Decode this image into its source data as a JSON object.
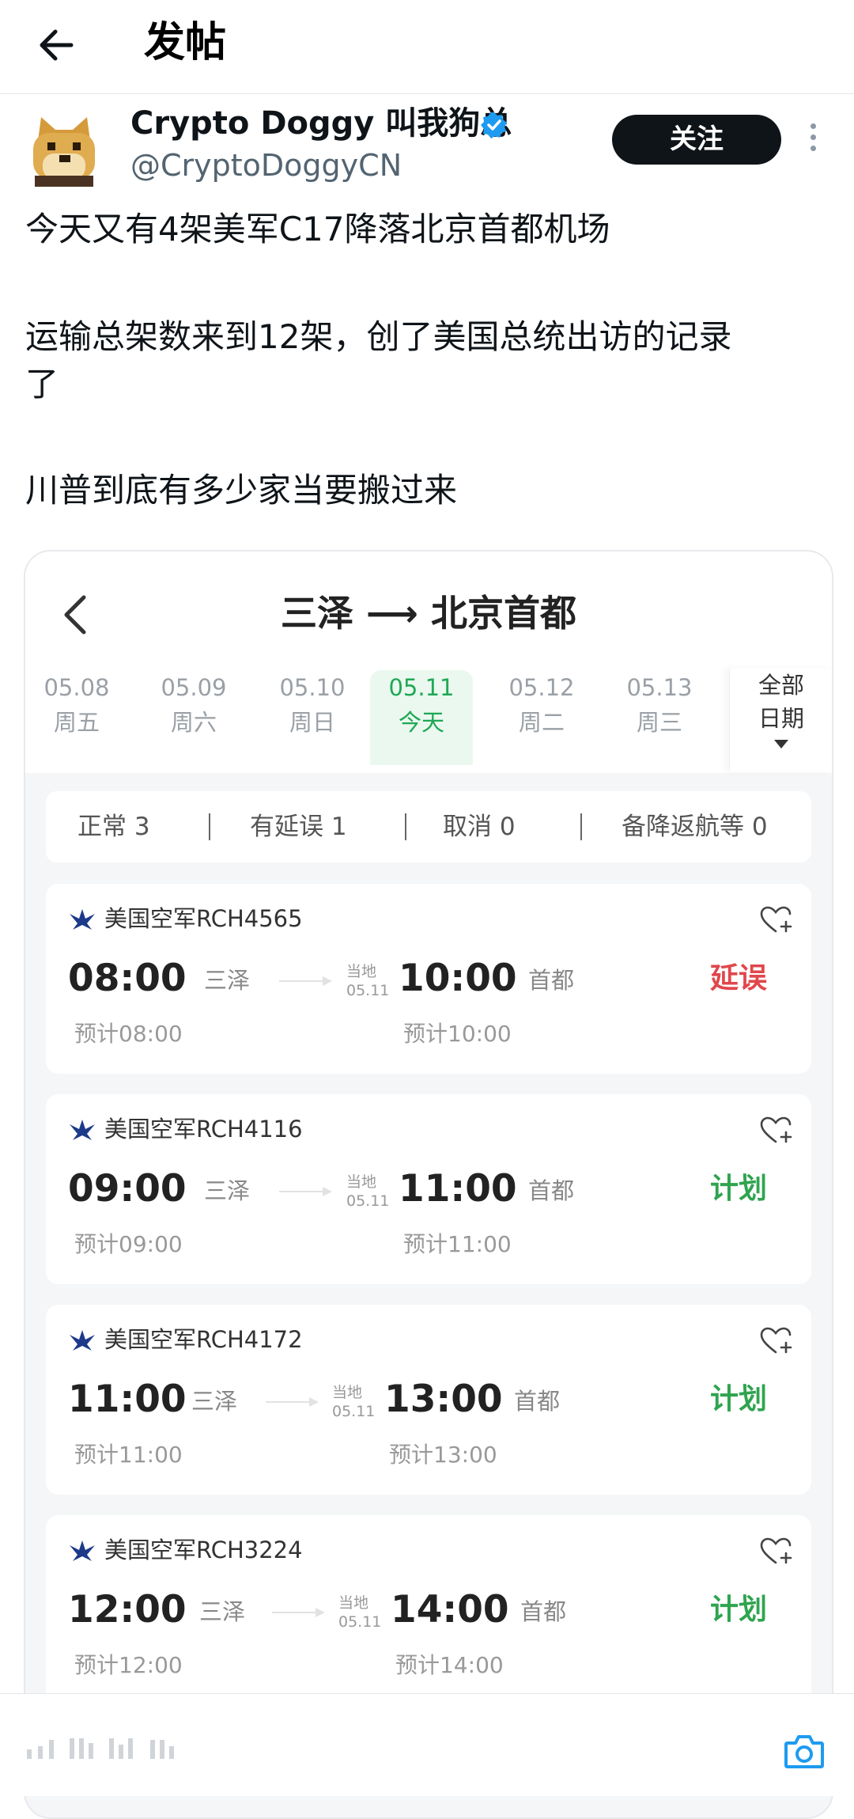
{
  "header": {
    "title": "发帖",
    "back_icon": "arrow-left-icon"
  },
  "author": {
    "name": "Crypto Doggy 叫我狗总",
    "handle": "@CryptoDoggyCN",
    "verified_color": "#1d9bf0",
    "follow_label": "关注",
    "avatar_icon": "doge-avatar-icon",
    "more_icon": "more-vertical-icon"
  },
  "post": {
    "lines": [
      "今天又有4架美军C17降落北京首都机场",
      "运输总架数来到12架，创了美国总统出访的记录",
      "了",
      "川普到底有多少家当要搬过来"
    ]
  },
  "embed": {
    "route": "三泽 ⟶ 北京首都",
    "back_icon": "chevron-left-icon",
    "dates": [
      {
        "date": "05.08",
        "day": "周五"
      },
      {
        "date": "05.09",
        "day": "周六"
      },
      {
        "date": "05.10",
        "day": "周日"
      },
      {
        "date": "05.11",
        "day": "今天"
      },
      {
        "date": "05.12",
        "day": "周二"
      },
      {
        "date": "05.13",
        "day": "周三"
      }
    ],
    "active_date_index": 3,
    "all_dates_line1": "全部",
    "all_dates_line2": "日期",
    "stats": {
      "normal": "正常 3",
      "delayed": "有延误 1",
      "cancelled": "取消 0",
      "diverted": "备降返航等 0"
    },
    "flights": [
      {
        "airline": "美国空军RCH4565",
        "dep_time": "08:00",
        "dep_airport": "三泽",
        "local_label": "当地",
        "local_date": "05.11",
        "arr_time": "10:00",
        "arr_airport": "首都",
        "dep_est": "预计08:00",
        "arr_est": "预计10:00",
        "status": "延误",
        "status_color": "#e0474c"
      },
      {
        "airline": "美国空军RCH4116",
        "dep_time": "09:00",
        "dep_airport": "三泽",
        "local_label": "当地",
        "local_date": "05.11",
        "arr_time": "11:00",
        "arr_airport": "首都",
        "dep_est": "预计09:00",
        "arr_est": "预计11:00",
        "status": "计划",
        "status_color": "#2fa44f"
      },
      {
        "airline": "美国空军RCH4172",
        "dep_time": "11:00",
        "dep_airport": "三泽",
        "local_label": "当地",
        "local_date": "05.11",
        "arr_time": "13:00",
        "arr_airport": "首都",
        "dep_est": "预计11:00",
        "arr_est": "预计13:00",
        "status": "计划",
        "status_color": "#2fa44f"
      },
      {
        "airline": "美国空军RCH3224",
        "dep_time": "12:00",
        "dep_airport": "三泽",
        "local_label": "当地",
        "local_date": "05.11",
        "arr_time": "14:00",
        "arr_airport": "首都",
        "dep_est": "预计12:00",
        "arr_est": "预计14:00",
        "status": "计划",
        "status_color": "#2fa44f"
      }
    ]
  },
  "bottom_bar": {
    "camera_icon": "camera-icon",
    "accent": "#1d9bf0"
  }
}
